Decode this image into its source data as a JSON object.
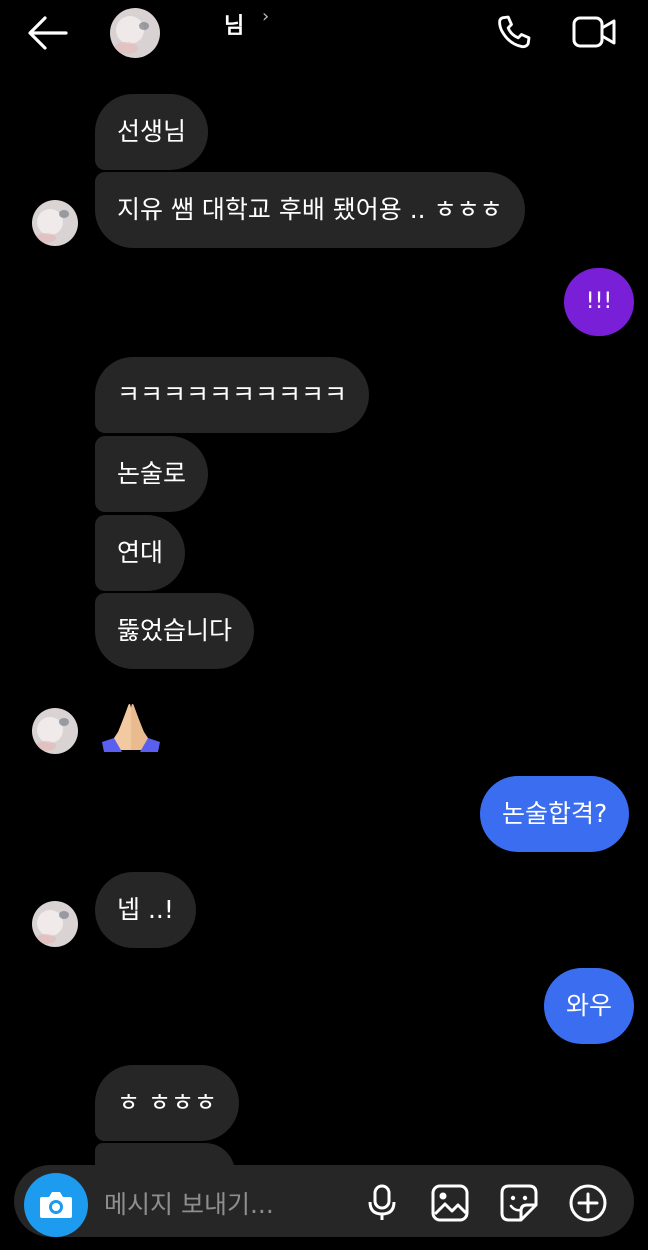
{
  "header": {
    "contact_name": "님",
    "chevron": "›",
    "icons": [
      "back-arrow-icon",
      "phone-icon",
      "video-camera-icon"
    ]
  },
  "messages": [
    {
      "from": "them",
      "text": "선생님"
    },
    {
      "from": "them",
      "text": "지유 쌤 대학교 후배 됐어용 .. ㅎㅎㅎ"
    },
    {
      "from": "me",
      "text": "!!!"
    },
    {
      "from": "them",
      "text": "ㅋㅋㅋㅋㅋㅋㅋㅋㅋㅋ"
    },
    {
      "from": "them",
      "text": "논술로"
    },
    {
      "from": "them",
      "text": "연대"
    },
    {
      "from": "them",
      "text": "뚫었습니다"
    },
    {
      "from": "them",
      "emoji": "folded-hands-emoji"
    },
    {
      "from": "me",
      "text": "논술합격?"
    },
    {
      "from": "them",
      "text": "넵 ..!"
    },
    {
      "from": "me",
      "text": "와우"
    },
    {
      "from": "them",
      "text": "ㅎ ㅎㅎㅎ"
    }
  ],
  "composer": {
    "placeholder": "메시지 보내기...",
    "icons": [
      "camera-icon",
      "microphone-icon",
      "gallery-icon",
      "sticker-icon",
      "add-icon"
    ]
  },
  "colors": {
    "background": "#000000",
    "incoming_bubble": "#262626",
    "outgoing_purple": "#7a1fd8",
    "outgoing_blue": "#3b6df0",
    "camera_button": "#1c9bef"
  }
}
